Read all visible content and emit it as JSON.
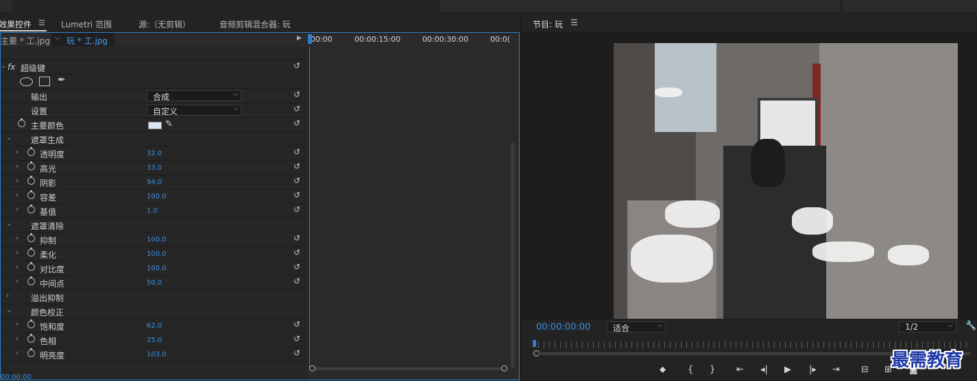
{
  "effects_panel": {
    "tabs": [
      {
        "label": "效果控件"
      },
      {
        "label": "Lumetri 范围"
      },
      {
        "label": "源:（无剪辑）"
      },
      {
        "label": "音频剪辑混合器: 玩"
      }
    ],
    "menu_icon": "hamburger-menu-icon",
    "clip_master": "主要 * 工.jpg",
    "clip_tab": "玩 * 工.jpg",
    "effect_name": "超级键",
    "fx_label": "fx",
    "properties": {
      "output_label": "输出",
      "output_value": "合成",
      "setting_label": "设置",
      "setting_value": "自定义",
      "key_color_label": "主要颜色",
      "key_color": "#d9e6f4",
      "matte_generation": "遮罩生成",
      "transparency_label": "透明度",
      "transparency": "32.0",
      "highlight_label": "高光",
      "highlight": "33.0",
      "shadow_label": "阴影",
      "shadow": "94.0",
      "tolerance_label": "容差",
      "tolerance": "100.0",
      "pedestal_label": "基值",
      "pedestal": "1.0",
      "matte_cleanup": "遮罩清除",
      "choke_label": "抑制",
      "choke": "100.0",
      "soften_label": "柔化",
      "soften": "100.0",
      "contrast_label": "对比度",
      "contrast": "100.0",
      "midpoint_label": "中间点",
      "midpoint": "50.0",
      "spill_suppression": "溢出抑制",
      "color_correction": "颜色校正",
      "saturation_label": "饱和度",
      "saturation": "62.0",
      "hue_label": "色相",
      "hue": "25.0",
      "luminance_label": "明亮度",
      "luminance": "103.0"
    },
    "timeline": {
      "tc0": "00:00",
      "tc1": "00:00:15:00",
      "tc2": "00:00:30:00",
      "tc3": "00:0(",
      "current": "00:00:00"
    }
  },
  "program_monitor": {
    "title": "节目: 玩",
    "timecode": "00:00:00:00",
    "zoom": "适合",
    "resolution": "1/2"
  },
  "watermark": "最需教育",
  "colors": {
    "accent": "#3b8fe5",
    "panel_border": "#2f7fd1"
  }
}
